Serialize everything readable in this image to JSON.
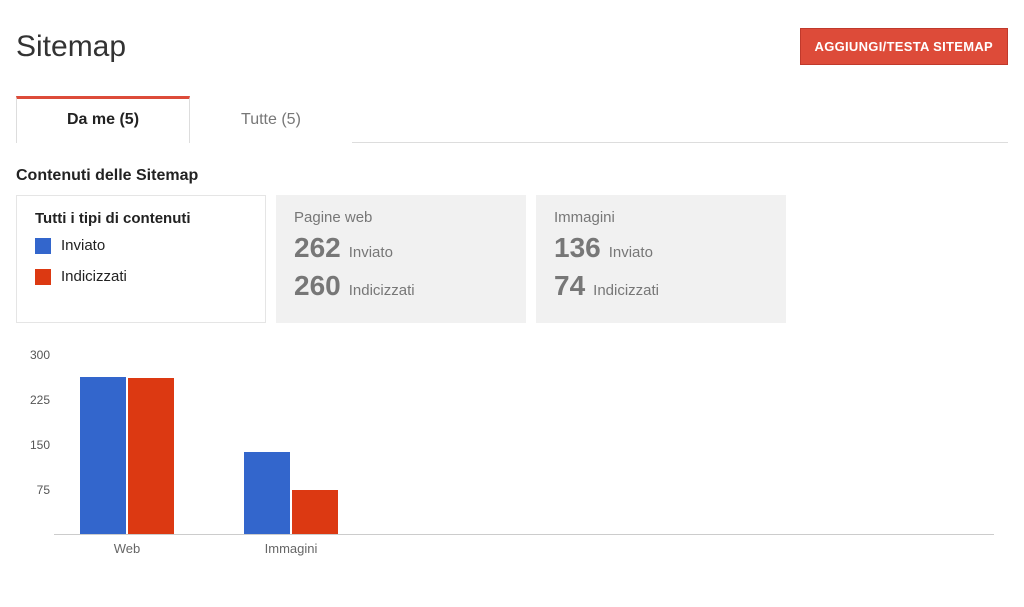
{
  "header": {
    "title": "Sitemap",
    "add_button": "AGGIUNGI/TESTA SITEMAP"
  },
  "tabs": {
    "items": [
      {
        "label": "Da me (5)",
        "active": true
      },
      {
        "label": "Tutte (5)",
        "active": false
      }
    ]
  },
  "section_title": "Contenuti delle Sitemap",
  "legend_panel": {
    "title": "Tutti i tipi di contenuti",
    "items": [
      {
        "label": "Inviato",
        "color": "#3366cc"
      },
      {
        "label": "Indicizzati",
        "color": "#dc3912"
      }
    ]
  },
  "stat_panels": [
    {
      "title": "Pagine web",
      "sent_value": "262",
      "sent_label": "Inviato",
      "indexed_value": "260",
      "indexed_label": "Indicizzati"
    },
    {
      "title": "Immagini",
      "sent_value": "136",
      "sent_label": "Inviato",
      "indexed_value": "74",
      "indexed_label": "Indicizzati"
    }
  ],
  "chart_data": {
    "type": "bar",
    "categories": [
      "Web",
      "Immagini"
    ],
    "series": [
      {
        "name": "Inviato",
        "color": "#3366cc",
        "values": [
          262,
          136
        ]
      },
      {
        "name": "Indicizzati",
        "color": "#dc3912",
        "values": [
          260,
          74
        ]
      }
    ],
    "ylim": [
      0,
      300
    ],
    "yticks": [
      75,
      150,
      225,
      300
    ],
    "xlabel": "",
    "ylabel": ""
  }
}
